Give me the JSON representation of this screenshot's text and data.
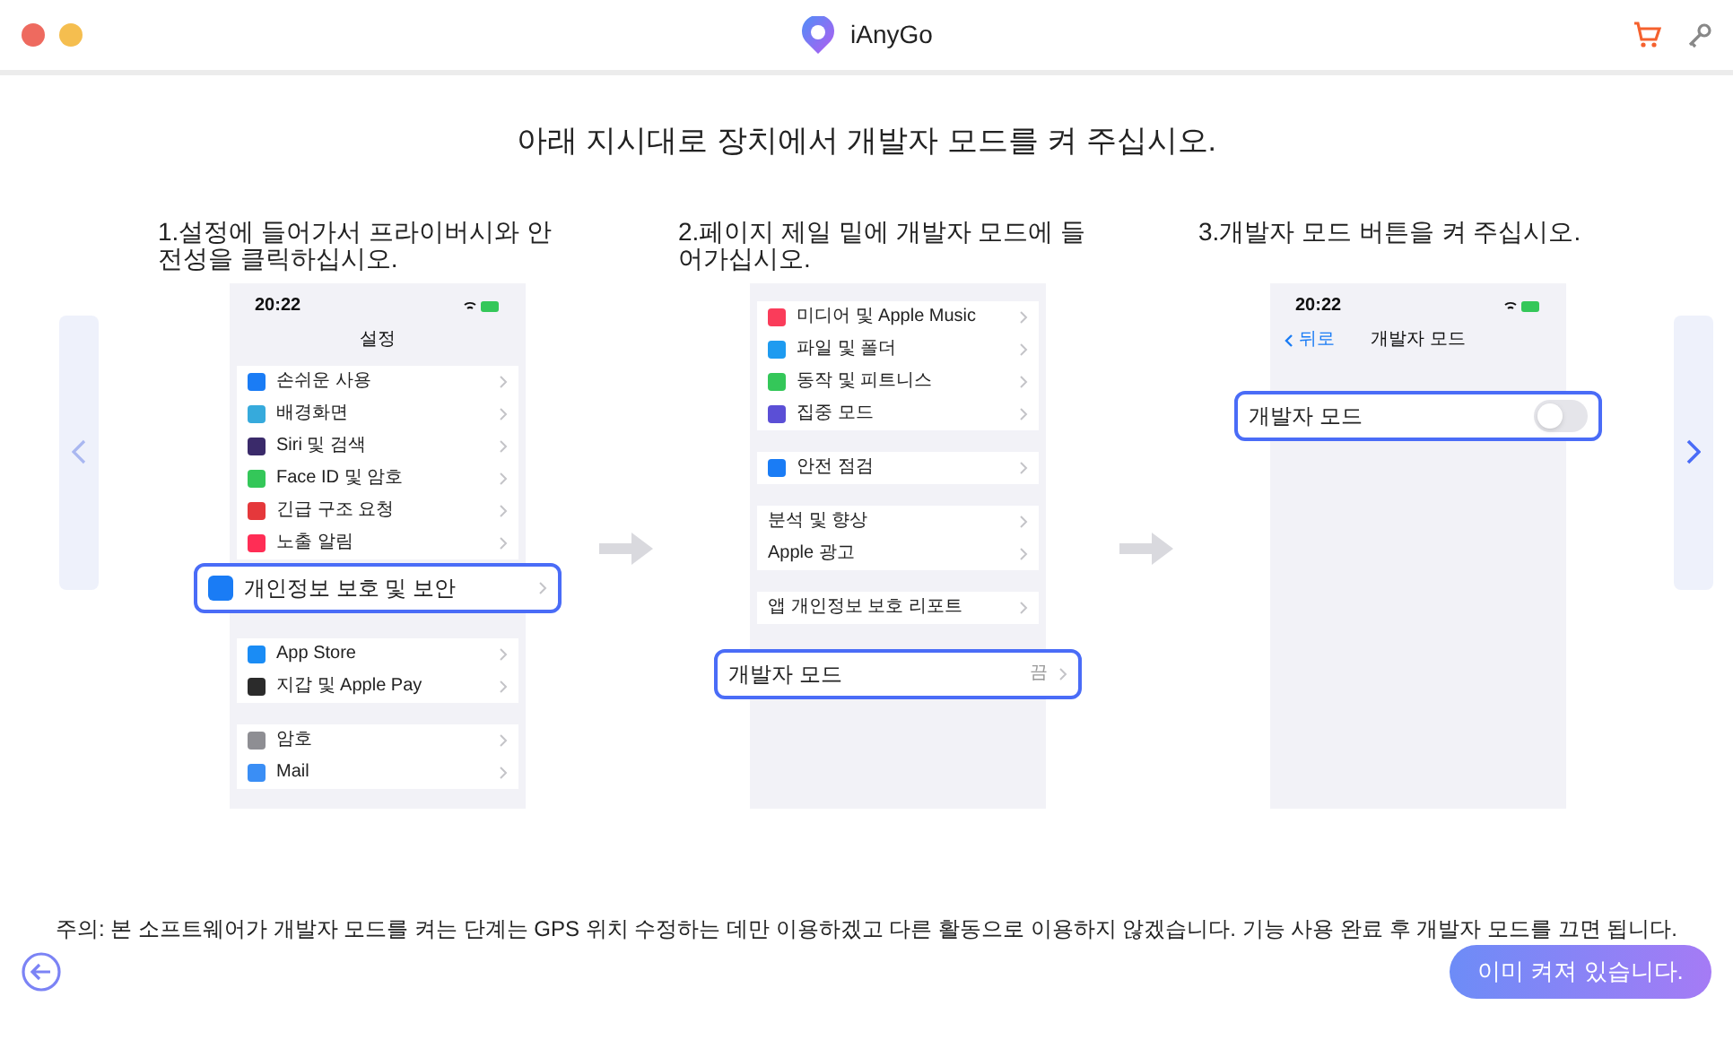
{
  "window": {
    "title": "iAnyGo"
  },
  "heading": "아래 지시대로 장치에서 개발자 모드를 켜 주십시오.",
  "steps": [
    {
      "caption": "1.설정에 들어가서 프라이버시와 안전성을 클릭하십시오.",
      "phone": {
        "time": "20:22",
        "title": "설정",
        "items": [
          {
            "kind": "row",
            "label": "손쉬운 사용",
            "color": "#1a7cf5"
          },
          {
            "kind": "row",
            "label": "배경화면",
            "color": "#36aadc"
          },
          {
            "kind": "row",
            "label": "Siri 및 검색",
            "color": "#3a2a6a"
          },
          {
            "kind": "row",
            "label": "Face ID 및 암호",
            "color": "#34c759"
          },
          {
            "kind": "row",
            "label": "긴급 구조 요청",
            "color": "#e5383b"
          },
          {
            "kind": "row",
            "label": "노출 알림",
            "color": "#ff2d55"
          },
          {
            "kind": "callout",
            "label": "개인정보 보호 및 보안",
            "color": "#1a7cf5"
          },
          {
            "kind": "gap"
          },
          {
            "kind": "row",
            "label": "App Store",
            "color": "#1a8cf5"
          },
          {
            "kind": "row",
            "label": "지갑 및 Apple Pay",
            "color": "#2b2b2b"
          },
          {
            "kind": "gap"
          },
          {
            "kind": "row",
            "label": "암호",
            "color": "#8e8e93"
          },
          {
            "kind": "row",
            "label": "Mail",
            "color": "#3a8ef5"
          }
        ]
      }
    },
    {
      "caption": "2.페이지 제일 밑에 개발자 모드에 들어가십시오.",
      "phone": {
        "items": [
          {
            "kind": "row",
            "label": "미디어 및 Apple Music",
            "color": "#fa3c5a"
          },
          {
            "kind": "row",
            "label": "파일 및 폴더",
            "color": "#1e9bf0"
          },
          {
            "kind": "row",
            "label": "동작 및 피트니스",
            "color": "#34c759"
          },
          {
            "kind": "row",
            "label": "집중 모드",
            "color": "#5b4fd6"
          },
          {
            "kind": "gap"
          },
          {
            "kind": "row",
            "label": "안전 점검",
            "color": "#1a7cf5"
          },
          {
            "kind": "gap"
          },
          {
            "kind": "row",
            "label": "분석 및 향상"
          },
          {
            "kind": "row",
            "label": "Apple 광고"
          },
          {
            "kind": "gap"
          },
          {
            "kind": "row",
            "label": "앱 개인정보 보호 리포트"
          },
          {
            "kind": "gap"
          },
          {
            "kind": "callout",
            "label": "개발자 모드",
            "value": "끔"
          }
        ]
      }
    },
    {
      "caption": "3.개발자 모드 버튼을 켜 주십시오.",
      "phone": {
        "time": "20:22",
        "back": "뒤로",
        "title": "개발자 모드",
        "items": [
          {
            "kind": "gap"
          },
          {
            "kind": "callout",
            "label": "개발자 모드",
            "toggle": {
              "on": false
            }
          }
        ]
      }
    }
  ],
  "note": "주의: 본 소프트웨어가 개발자 모드를 켜는 단계는 GPS 위치 수정하는 데만 이용하겠고 다른 활동으로 이용하지 않겠습니다. 기능 사용 완료 후 개발자 모드를 끄면 됩니다.",
  "primary_button": "이미 켜져 있습니다."
}
